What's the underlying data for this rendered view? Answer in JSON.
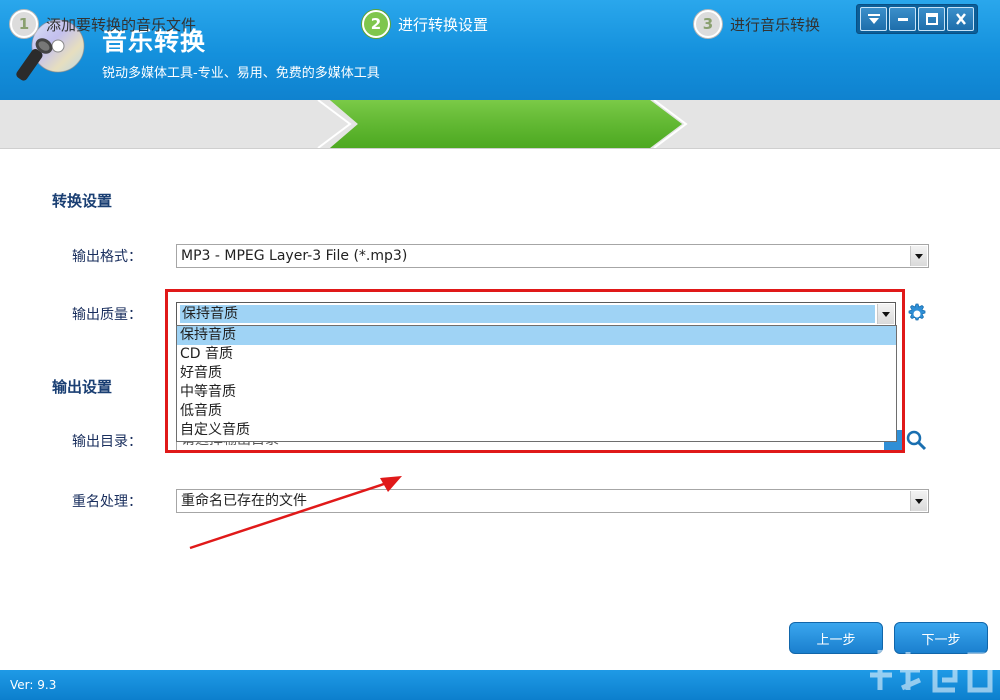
{
  "window": {
    "title": "音乐转换",
    "subtitle": "锐动多媒体工具-专业、易用、免费的多媒体工具",
    "controls": [
      "menu-icon",
      "minimize-icon",
      "maximize-icon",
      "close-icon"
    ]
  },
  "steps": [
    {
      "number": "1",
      "label": "添加要转换的音乐文件",
      "active": false
    },
    {
      "number": "2",
      "label": "进行转换设置",
      "active": true
    },
    {
      "number": "3",
      "label": "进行音乐转换",
      "active": false
    }
  ],
  "conversion_section": {
    "title": "转换设置",
    "format_label": "输出格式：",
    "format_value": "MP3 - MPEG Layer-3 File (*.mp3)",
    "quality_label": "输出质量：",
    "quality_value": "保持音质",
    "quality_options": [
      "保持音质",
      "CD 音质",
      "好音质",
      "中等音质",
      "低音质",
      "自定义音质"
    ]
  },
  "output_section": {
    "title": "输出设置",
    "dir_label": "输出目录：",
    "dir_placeholder": "请选择输出目录",
    "rename_label": "重名处理：",
    "rename_value": "重命名已存在的文件"
  },
  "buttons": {
    "prev": "上一步",
    "next": "下一步"
  },
  "status": {
    "version": "Ver: 9.3"
  },
  "colors": {
    "titlebar": "#1490dc",
    "active_step": "#5cb82c",
    "highlight": "#e01919",
    "arrow": "#e01919"
  }
}
